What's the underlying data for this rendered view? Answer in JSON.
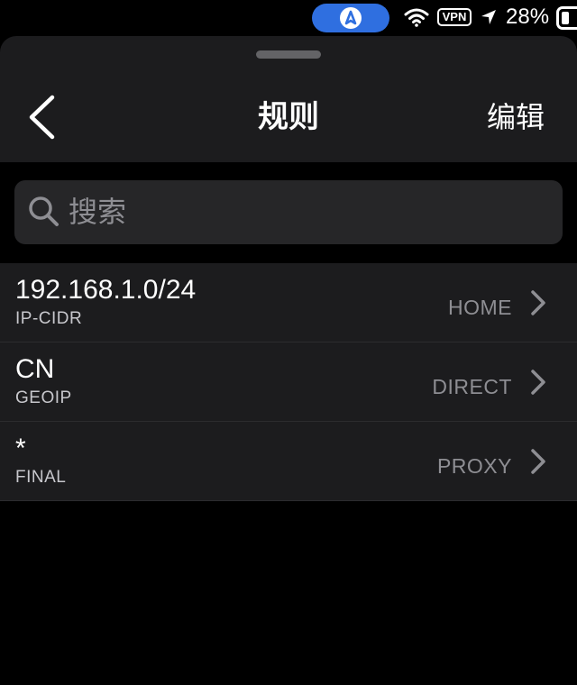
{
  "status_bar": {
    "vpn_label": "VPN",
    "battery_percent": "28%",
    "battery_level": 0.28,
    "icons": [
      "navigation-pill-icon",
      "wifi-icon",
      "location-arrow-icon",
      "battery-icon"
    ]
  },
  "header": {
    "title": "规则",
    "edit_label": "编辑",
    "back_icon": "chevron-left-icon"
  },
  "search": {
    "placeholder": "搜索",
    "icon": "search-icon"
  },
  "rules": [
    {
      "value": "192.168.1.0/24",
      "type": "IP-CIDR",
      "policy": "HOME"
    },
    {
      "value": "CN",
      "type": "GEOIP",
      "policy": "DIRECT"
    },
    {
      "value": "*",
      "type": "FINAL",
      "policy": "PROXY"
    }
  ],
  "colors": {
    "background": "#000000",
    "surface": "#1c1c1e",
    "search_field": "#262628",
    "secondary_text": "#8e8e93",
    "nav_pill": "#2f6fe0"
  }
}
